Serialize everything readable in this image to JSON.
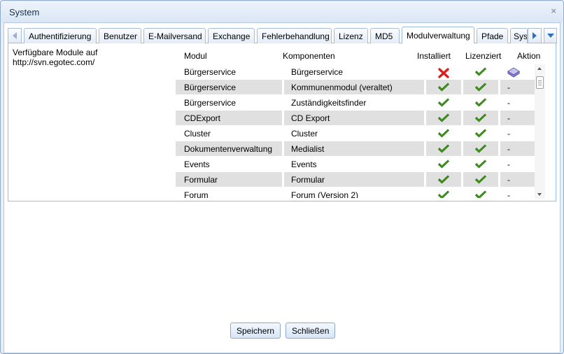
{
  "dialog": {
    "title": "System",
    "close_symbol": "×"
  },
  "tabs": [
    {
      "label": "Authentifizierung"
    },
    {
      "label": "Benutzer"
    },
    {
      "label": "E-Mailversand"
    },
    {
      "label": "Exchange"
    },
    {
      "label": "Fehlerbehandlung"
    },
    {
      "label": "Lizenz"
    },
    {
      "label": "MD5"
    },
    {
      "label": "Modulverwaltung",
      "active": true
    },
    {
      "label": "Pfade"
    },
    {
      "label": "Syst"
    }
  ],
  "panel": {
    "label": "Verfügbare Module auf http://svn.egotec.com/",
    "columns": {
      "modul": "Modul",
      "komponenten": "Komponenten",
      "installiert": "Installiert",
      "lizenziert": "Lizenziert",
      "aktion": "Aktion"
    },
    "rows": [
      {
        "modul": "Bürgerservice",
        "komponente": "Bürgerservice",
        "installiert": "cross-icon",
        "lizenziert": "check-icon",
        "aktion": "install-icon"
      },
      {
        "modul": "Bürgerservice",
        "komponente": "Kommunenmodul (veraltet)",
        "installiert": "check-icon",
        "lizenziert": "check-icon",
        "aktion": "-"
      },
      {
        "modul": "Bürgerservice",
        "komponente": "Zuständigkeitsfinder",
        "installiert": "check-icon",
        "lizenziert": "check-icon",
        "aktion": "-"
      },
      {
        "modul": "CDExport",
        "komponente": "CD Export",
        "installiert": "check-icon",
        "lizenziert": "check-icon",
        "aktion": "-"
      },
      {
        "modul": "Cluster",
        "komponente": "Cluster",
        "installiert": "check-icon",
        "lizenziert": "check-icon",
        "aktion": "-"
      },
      {
        "modul": "Dokumentenverwaltung",
        "komponente": "Medialist",
        "installiert": "check-icon",
        "lizenziert": "check-icon",
        "aktion": "-"
      },
      {
        "modul": "Events",
        "komponente": "Events",
        "installiert": "check-icon",
        "lizenziert": "check-icon",
        "aktion": "-"
      },
      {
        "modul": "Formular",
        "komponente": "Formular",
        "installiert": "check-icon",
        "lizenziert": "check-icon",
        "aktion": "-"
      },
      {
        "modul": "Forum",
        "komponente": "Forum (Version 2)",
        "installiert": "check-icon",
        "lizenziert": "check-icon",
        "aktion": "-"
      }
    ]
  },
  "buttons": {
    "save": "Speichern",
    "close": "Schließen"
  },
  "colors": {
    "check": "#3f9a1c",
    "cross": "#d81e1e",
    "tab_border": "#99bbe8",
    "row_alt": "#e0e0e0"
  }
}
